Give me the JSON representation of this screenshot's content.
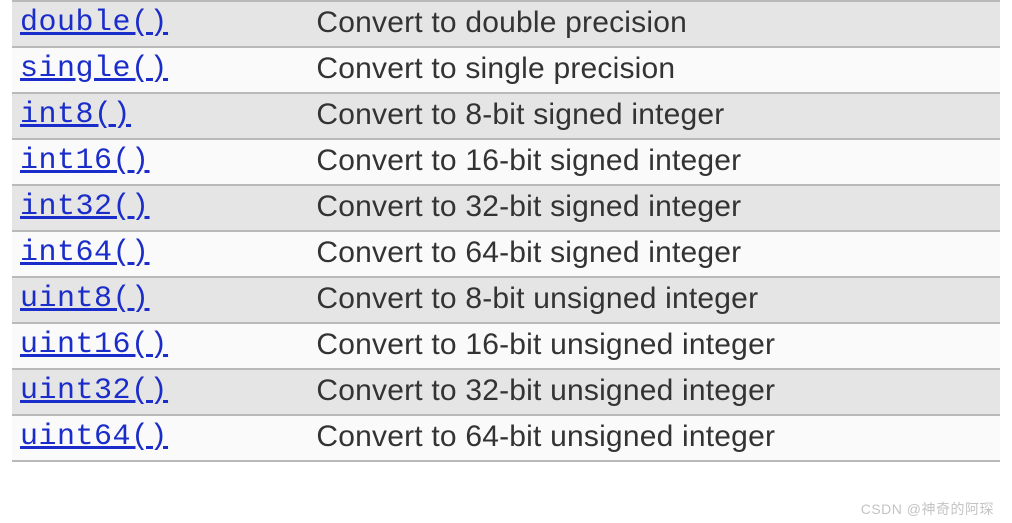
{
  "rows": [
    {
      "func": "double()",
      "desc": "Convert to double precision",
      "shade": true
    },
    {
      "func": "single()",
      "desc": "Convert to single precision",
      "shade": false
    },
    {
      "func": "int8()",
      "desc": "Convert to 8-bit signed integer",
      "shade": true
    },
    {
      "func": "int16()",
      "desc": "Convert to 16-bit signed integer",
      "shade": false
    },
    {
      "func": "int32()",
      "desc": "Convert to 32-bit signed integer",
      "shade": true
    },
    {
      "func": "int64()",
      "desc": "Convert to 64-bit signed integer",
      "shade": false
    },
    {
      "func": "uint8()",
      "desc": "Convert to 8-bit unsigned integer",
      "shade": true
    },
    {
      "func": "uint16()",
      "desc": "Convert to 16-bit unsigned integer",
      "shade": false
    },
    {
      "func": "uint32()",
      "desc": "Convert to 32-bit unsigned integer",
      "shade": true
    },
    {
      "func": "uint64()",
      "desc": "Convert to 64-bit unsigned integer",
      "shade": false
    }
  ],
  "watermark": "CSDN @神奇的阿琛"
}
